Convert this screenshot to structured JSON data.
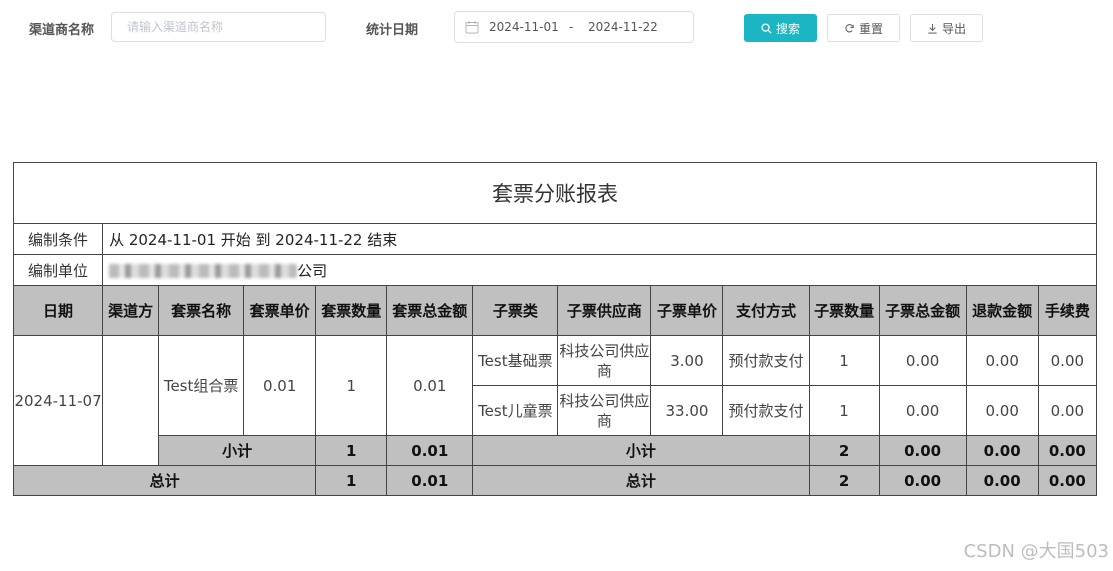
{
  "filters": {
    "channel_label": "渠道商名称",
    "channel_placeholder": "请输入渠道商名称",
    "date_label": "统计日期",
    "date_start": "2024-11-01",
    "date_sep": "-",
    "date_end": "2024-11-22",
    "search_label": "搜索",
    "reset_label": "重置",
    "export_label": "导出",
    "accent_color": "#1ab6c4"
  },
  "report": {
    "title": "套票分账报表",
    "condition_label": "编制条件",
    "condition_value": "从 2024-11-01 开始 到 2024-11-22 结束",
    "unit_label": "编制单位",
    "unit_value_suffix": "公司",
    "headers": {
      "date": "日期",
      "channel": "渠道方",
      "package_name": "套票名称",
      "package_price": "套票单价",
      "package_qty": "套票数量",
      "package_total": "套票总金额",
      "sub_type": "子票类",
      "sub_supplier": "子票供应商",
      "sub_price": "子票单价",
      "pay_method": "支付方式",
      "sub_qty": "子票数量",
      "sub_total": "子票总金额",
      "refund": "退款金额",
      "fee": "手续费"
    },
    "group": {
      "date": "2024-11-07",
      "channel": "",
      "package_name": "Test组合票",
      "package_price": "0.01",
      "package_qty": "1",
      "package_total": "0.01",
      "subs": [
        {
          "type": "Test基础票",
          "supplier": "科技公司供应商",
          "price": "3.00",
          "pay": "预付款支付",
          "qty": "1",
          "total": "0.00",
          "refund": "0.00",
          "fee": "0.00"
        },
        {
          "type": "Test儿童票",
          "supplier": "科技公司供应商",
          "price": "33.00",
          "pay": "预付款支付",
          "qty": "1",
          "total": "0.00",
          "refund": "0.00",
          "fee": "0.00"
        }
      ],
      "subtotal_label": "小计",
      "subtotal_package_qty": "1",
      "subtotal_package_total": "0.01",
      "subtotal_sub_label": "小计",
      "subtotal_sub_qty": "2",
      "subtotal_sub_total": "0.00",
      "subtotal_refund": "0.00",
      "subtotal_fee": "0.00"
    },
    "total": {
      "label": "总计",
      "package_qty": "1",
      "package_total": "0.01",
      "sub_label": "总计",
      "sub_qty": "2",
      "sub_total": "0.00",
      "refund": "0.00",
      "fee": "0.00"
    }
  },
  "watermark": "CSDN @大国503"
}
